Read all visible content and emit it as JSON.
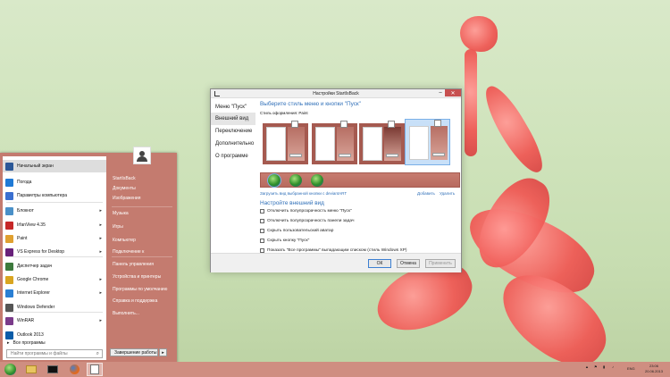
{
  "dialog": {
    "title": "Настройки StartIsBack",
    "nav": [
      "Меню \"Пуск\"",
      "Внешний вид",
      "Переключение",
      "Дополнительно",
      "О программе"
    ],
    "heading_style": "Выберите стиль меню и кнопки \"Пуск\"",
    "style_label": "Стиль оформления: Paint",
    "link_load": "Загрузить вид выбранной кнопки с deviantART",
    "link_add": "Добавить",
    "link_remove": "Удалить",
    "heading_appearance": "Настройте внешний вид",
    "options": [
      "Отключить полупрозрачность меню \"Пуск\"",
      "Отключить полупрозрачность панели задач",
      "Скрыть пользовательский аватар",
      "Скрыть кнопку \"Пуск\"",
      "Показать \"Все программы\" выпадающим списком (стиль Windows XP)"
    ],
    "ok_label": "ОК",
    "cancel_label": "Отмена",
    "apply_label": "Применить"
  },
  "start_menu": {
    "programs": [
      {
        "label": "Начальный экран",
        "color": "#2b5797",
        "arrow": false
      },
      {
        "label": "Погода",
        "color": "#1f7ad6",
        "arrow": false
      },
      {
        "label": "Параметры компьютера",
        "color": "#3a6fd0",
        "arrow": false
      },
      {
        "label": "Блокнот",
        "color": "#4a90c8",
        "arrow": true
      },
      {
        "label": "IrfanView 4.35",
        "color": "#c62828",
        "arrow": true
      },
      {
        "label": "Paint",
        "color": "#e0a030",
        "arrow": true
      },
      {
        "label": "VS Express for Desktop",
        "color": "#68217a",
        "arrow": true
      },
      {
        "label": "Диспетчер задач",
        "color": "#3d7a3d",
        "arrow": false
      },
      {
        "label": "Google Chrome",
        "color": "#d9a520",
        "arrow": true
      },
      {
        "label": "Internet Explorer",
        "color": "#2a7fd4",
        "arrow": true
      },
      {
        "label": "Windows Defender",
        "color": "#555555",
        "arrow": false
      },
      {
        "label": "WinRAR",
        "color": "#7a3b8a",
        "arrow": true
      },
      {
        "label": "Outlook 2013",
        "color": "#0a5ca8",
        "arrow": false
      }
    ],
    "all_programs": "Все программы",
    "search_placeholder": "Найти программы и файлы",
    "right_items": [
      "StartIsBack",
      "Документы",
      "Изображения",
      "Музыка",
      "Игры",
      "Компьютер",
      "Подключение к",
      "Панель управления",
      "Устройства и принтеры",
      "Программы по умолчанию",
      "Справка и поддержка",
      "Выполнить..."
    ],
    "shutdown_label": "Завершение работы"
  },
  "taskbar": {
    "lang": "ENG",
    "time": "23:06",
    "date": "20.06.2013"
  }
}
